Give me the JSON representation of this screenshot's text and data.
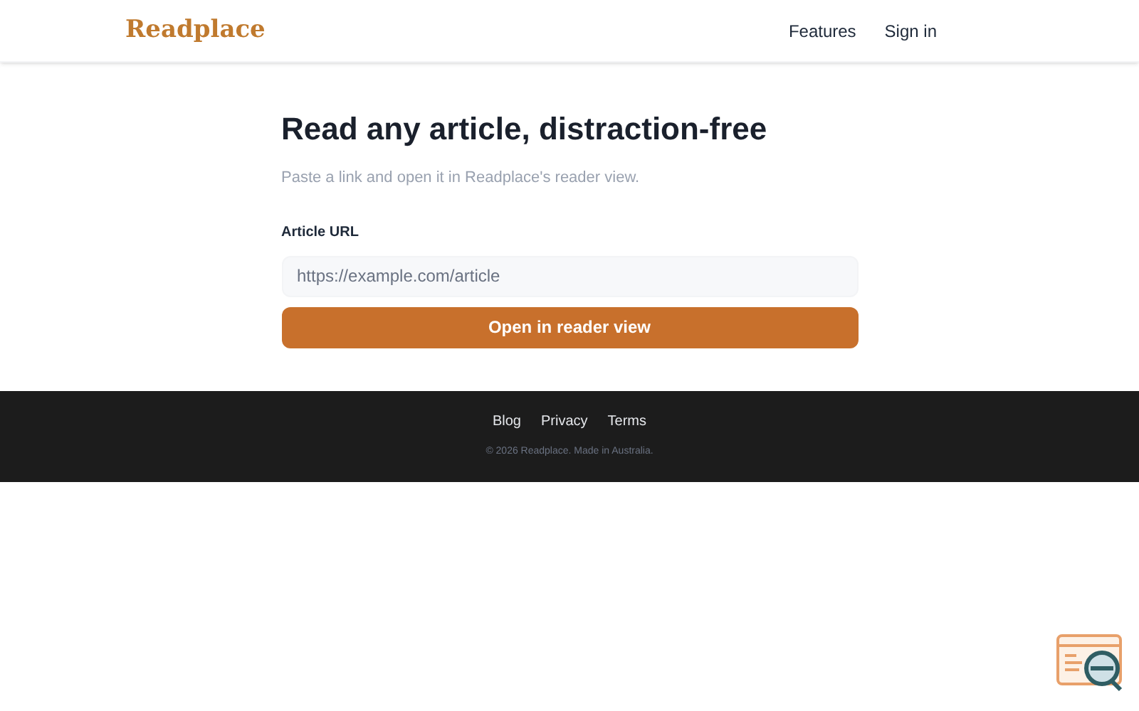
{
  "header": {
    "logo": "Readplace",
    "nav": [
      "Features",
      "Sign in"
    ]
  },
  "main": {
    "title": "Read any article, distraction-free",
    "subtitle": "Paste a link and open it in Readplace's reader view.",
    "field_label": "Article URL",
    "field": {
      "placeholder": "https://example.com/article"
    },
    "button": "Open in reader view"
  },
  "footer": {
    "links": [
      "Blog",
      "Privacy",
      "Terms"
    ],
    "copyright": "© 2026 Readplace. Made in Australia."
  }
}
